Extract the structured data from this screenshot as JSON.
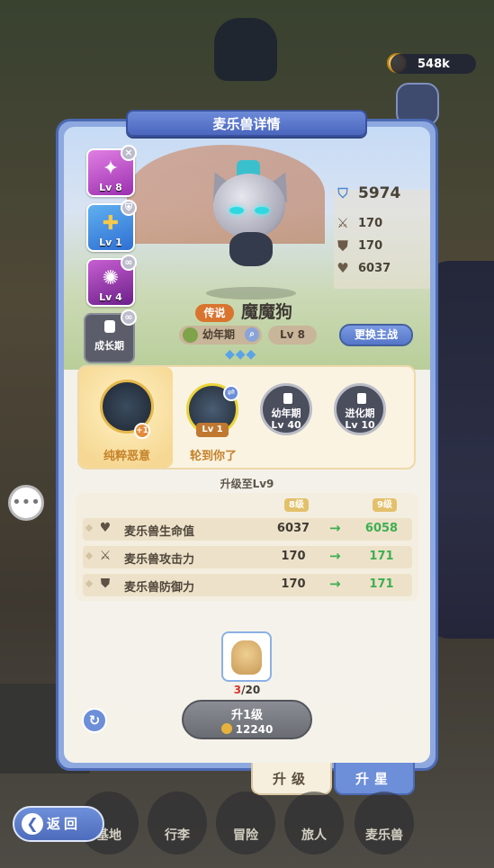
{
  "currency": {
    "gold": "548k"
  },
  "panel": {
    "title": "麦乐兽详情"
  },
  "side_monsters": [
    {
      "level": "Lv 8",
      "badge": "×",
      "color": "#c451c8"
    },
    {
      "level": "Lv 1",
      "badge": "⛨",
      "color": "#e7b740"
    },
    {
      "level": "Lv 4",
      "badge": "∞",
      "color": "#a93fb8"
    }
  ],
  "growth": {
    "label": "成长期"
  },
  "stats": {
    "power": "5974",
    "attack": "170",
    "defense": "170",
    "hp": "6037"
  },
  "pet": {
    "rarity": "传说",
    "name": "魔魔狗",
    "stage": "幼年期",
    "level": "Lv 8",
    "switch_label": "更换主战",
    "stars": "◆◆◆"
  },
  "skills": [
    {
      "label": "纯粹恶意",
      "badge": "+1"
    },
    {
      "label": "轮到你了",
      "badge": "Lv 1"
    }
  ],
  "evolutions": [
    {
      "name": "幼年期",
      "level": "Lv 40"
    },
    {
      "name": "进化期",
      "level": "Lv 10"
    }
  ],
  "upgrade": {
    "title": "升级至Lv9",
    "col_current": "8级",
    "col_next": "9级",
    "rows": [
      {
        "label": "麦乐兽生命值",
        "current": "6037",
        "next": "6058",
        "icon": "heart-icon"
      },
      {
        "label": "麦乐兽攻击力",
        "current": "170",
        "next": "171",
        "icon": "swords-icon"
      },
      {
        "label": "麦乐兽防御力",
        "current": "170",
        "next": "171",
        "icon": "shield-icon"
      }
    ]
  },
  "item": {
    "count_current": "3",
    "count_total": "/20"
  },
  "upgrade_button": {
    "label": "升1级",
    "cost": "12240"
  },
  "tabs": {
    "upgrade": "升级",
    "star": "升星"
  },
  "back": {
    "label": "返回"
  },
  "nav": [
    "基地",
    "行李",
    "冒险",
    "旅人",
    "麦乐兽"
  ]
}
